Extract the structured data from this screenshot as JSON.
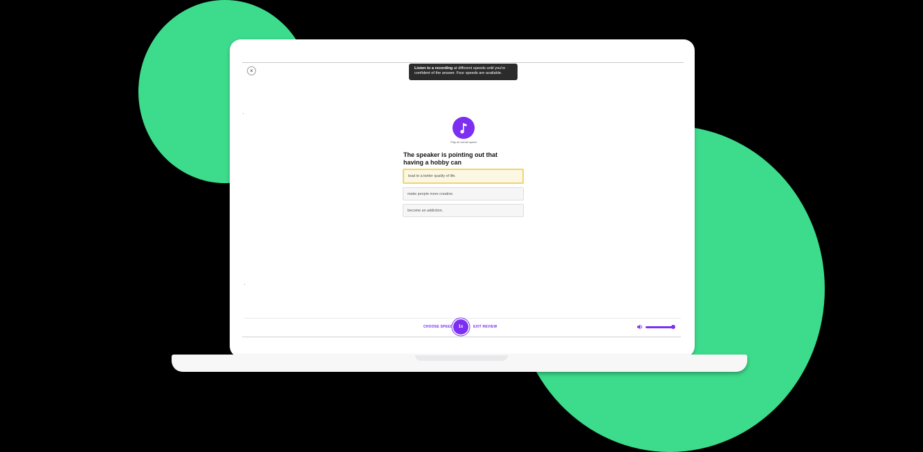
{
  "tooltip": {
    "bold": "Listen to a recording",
    "rest": " at different speeds until you're confident of the answer. Four speeds are available."
  },
  "close_label": "×",
  "player": {
    "caption": "Play at normal speed",
    "icon": "music-note-icon",
    "accent": "#7c2ff0"
  },
  "question": "The speaker is pointing out that having a hobby can",
  "options": [
    {
      "label": "lead to a better quality of life.",
      "selected": true
    },
    {
      "label": "make people more creative.",
      "selected": false
    },
    {
      "label": "become an addiction.",
      "selected": false
    }
  ],
  "footer": {
    "choose_speed": "CHOOSE SPEED",
    "speed_value": "1x",
    "exit_review": "EXIT REVIEW",
    "volume_level": 1.0
  },
  "colors": {
    "background": "#000000",
    "blob": "#3ddc8c",
    "selected_border": "#efd66a"
  }
}
